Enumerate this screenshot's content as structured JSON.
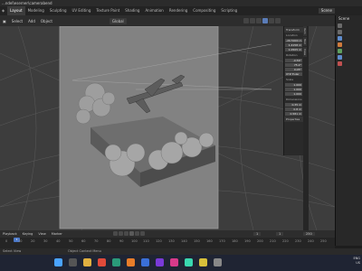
{
  "window": {
    "title": "...ndel\\eserner\\camerabend"
  },
  "menubar": {
    "tabs": [
      "Layout",
      "Modeling",
      "Sculpting",
      "UV Editing",
      "Texture Paint",
      "Shading",
      "Animation",
      "Rendering",
      "Compositing",
      "Scripting"
    ],
    "active_index": 0,
    "scene": "Scene"
  },
  "header": {
    "items": [
      "Select",
      "Add",
      "Object"
    ],
    "mode": "Global"
  },
  "n_panel": {
    "transform_title": "Transform",
    "location_label": "Location",
    "location": [
      "-20.5000 m",
      "1.4158 m",
      "1.0505 m"
    ],
    "rotation_label": "Rotation",
    "rotation": [
      "-0.56°",
      "75.2°",
      "0.05°"
    ],
    "rotation_mode": "XYZ Euler",
    "scale_label": "Scale",
    "scale": [
      "1.000",
      "1.000",
      "1.000"
    ],
    "dimensions_label": "Dimensions",
    "dimensions": [
      "0.35 m",
      "0.8 m",
      "0.581 m"
    ],
    "properties_title": "Properties"
  },
  "side_tabs": [
    "Item",
    "Tool",
    "View"
  ],
  "timeline": {
    "items": [
      "Playback",
      "Keying",
      "View",
      "Marker"
    ],
    "current_frame": "1",
    "ticks": [
      "0",
      "10",
      "20",
      "30",
      "40",
      "50",
      "60",
      "70",
      "80",
      "90",
      "100",
      "110",
      "120",
      "130",
      "140",
      "150",
      "160",
      "170",
      "180",
      "190",
      "200",
      "210",
      "220",
      "230",
      "240",
      "250"
    ],
    "start": "1",
    "end": "250"
  },
  "statusbar": {
    "left": "Select View",
    "middle": "Object Context Menu"
  },
  "taskbar": {
    "tray_line1": "ENG",
    "tray_line2": "US"
  },
  "colors": {
    "accent": "#4b78c8",
    "viewport_bg": "#3d3d3d",
    "camera_frame": "#8e8e8e"
  }
}
